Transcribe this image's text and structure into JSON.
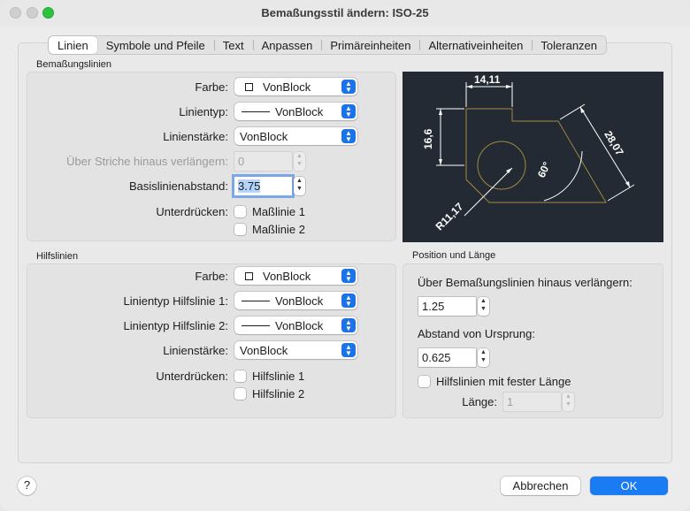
{
  "window": {
    "title": "Bemaßungsstil ändern: ISO-25"
  },
  "tabs": [
    "Linien",
    "Symbole und Pfeile",
    "Text",
    "Anpassen",
    "Primäreinheiten",
    "Alternativeinheiten",
    "Toleranzen"
  ],
  "active_tab": "Linien",
  "dimension_lines": {
    "group_label": "Bemaßungslinien",
    "color_label": "Farbe:",
    "color_value": "VonBlock",
    "linetype_label": "Linientyp:",
    "linetype_value": "VonBlock",
    "lineweight_label": "Linienstärke:",
    "lineweight_value": "VonBlock",
    "extend_label": "Über Striche hinaus verlängern:",
    "extend_value": "0",
    "baseline_label": "Basislinienabstand:",
    "baseline_value": "3.75",
    "suppress_label": "Unterdrücken:",
    "suppress_1": "Maßlinie 1",
    "suppress_2": "Maßlinie 2"
  },
  "extension_lines": {
    "group_label": "Hilfslinien",
    "color_label": "Farbe:",
    "color_value": "VonBlock",
    "linetype1_label": "Linientyp Hilfslinie 1:",
    "linetype1_value": "VonBlock",
    "linetype2_label": "Linientyp Hilfslinie 2:",
    "linetype2_value": "VonBlock",
    "lineweight_label": "Linienstärke:",
    "lineweight_value": "VonBlock",
    "suppress_label": "Unterdrücken:",
    "suppress_1": "Hilfslinie 1",
    "suppress_2": "Hilfslinie 2"
  },
  "position": {
    "group_label": "Position und Länge",
    "beyond_label": "Über Bemaßungslinien hinaus verlängern:",
    "beyond_value": "1.25",
    "offset_label": "Abstand von Ursprung:",
    "offset_value": "0.625",
    "fixed_label": "Hilfslinien mit fester Länge",
    "length_label": "Länge:",
    "length_value": "1"
  },
  "preview": {
    "dim_top": "14,11",
    "dim_left": "16,6",
    "dim_right": "28,07",
    "dim_angle": "60°",
    "dim_radius": "R11,17"
  },
  "buttons": {
    "help": "?",
    "cancel": "Abbrechen",
    "ok": "OK"
  },
  "colors": {
    "accent": "#1a7cf2",
    "preview_bg": "#232a33",
    "preview_shape": "#a08a3c",
    "preview_dim": "#ffffff"
  },
  "icons": {
    "help": "question-mark",
    "popup": "chevron-up-down",
    "stepper": "stepper-arrows"
  }
}
